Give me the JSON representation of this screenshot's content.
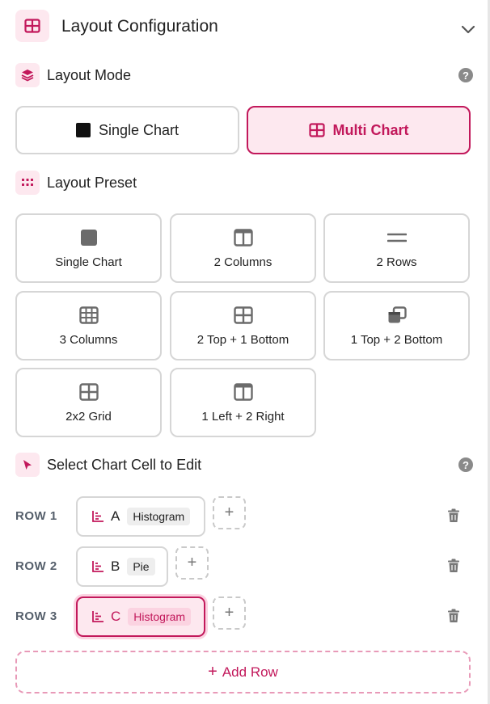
{
  "header": {
    "title": "Layout Configuration",
    "icon": "grid-icon",
    "accent": "#c2185b"
  },
  "layout_mode": {
    "title": "Layout Mode",
    "help": "?",
    "options": [
      {
        "label": "Single Chart",
        "icon": "square-icon",
        "selected": false
      },
      {
        "label": "Multi Chart",
        "icon": "grid-icon",
        "selected": true
      }
    ]
  },
  "layout_preset": {
    "title": "Layout Preset",
    "presets": [
      {
        "label": "Single Chart",
        "icon": "square-icon"
      },
      {
        "label": "2 Columns",
        "icon": "columns-icon"
      },
      {
        "label": "2 Rows",
        "icon": "rows-icon"
      },
      {
        "label": "3 Columns",
        "icon": "table-grid-icon"
      },
      {
        "label": "2 Top + 1 Bottom",
        "icon": "grid-icon"
      },
      {
        "label": "1 Top + 2 Bottom",
        "icon": "stacked-windows-icon"
      },
      {
        "label": "2x2 Grid",
        "icon": "grid-icon"
      },
      {
        "label": "1 Left + 2 Right",
        "icon": "columns-icon"
      }
    ]
  },
  "cell_editor": {
    "title": "Select Chart Cell to Edit",
    "help": "?",
    "add_symbol": "+",
    "rows": [
      {
        "label": "ROW 1",
        "cells": [
          {
            "letter": "A",
            "type": "Histogram",
            "active": false
          }
        ]
      },
      {
        "label": "ROW 2",
        "cells": [
          {
            "letter": "B",
            "type": "Pie",
            "active": false
          }
        ]
      },
      {
        "label": "ROW 3",
        "cells": [
          {
            "letter": "C",
            "type": "Histogram",
            "active": true
          }
        ]
      }
    ],
    "add_row": {
      "symbol": "+",
      "label": "Add Row"
    }
  }
}
